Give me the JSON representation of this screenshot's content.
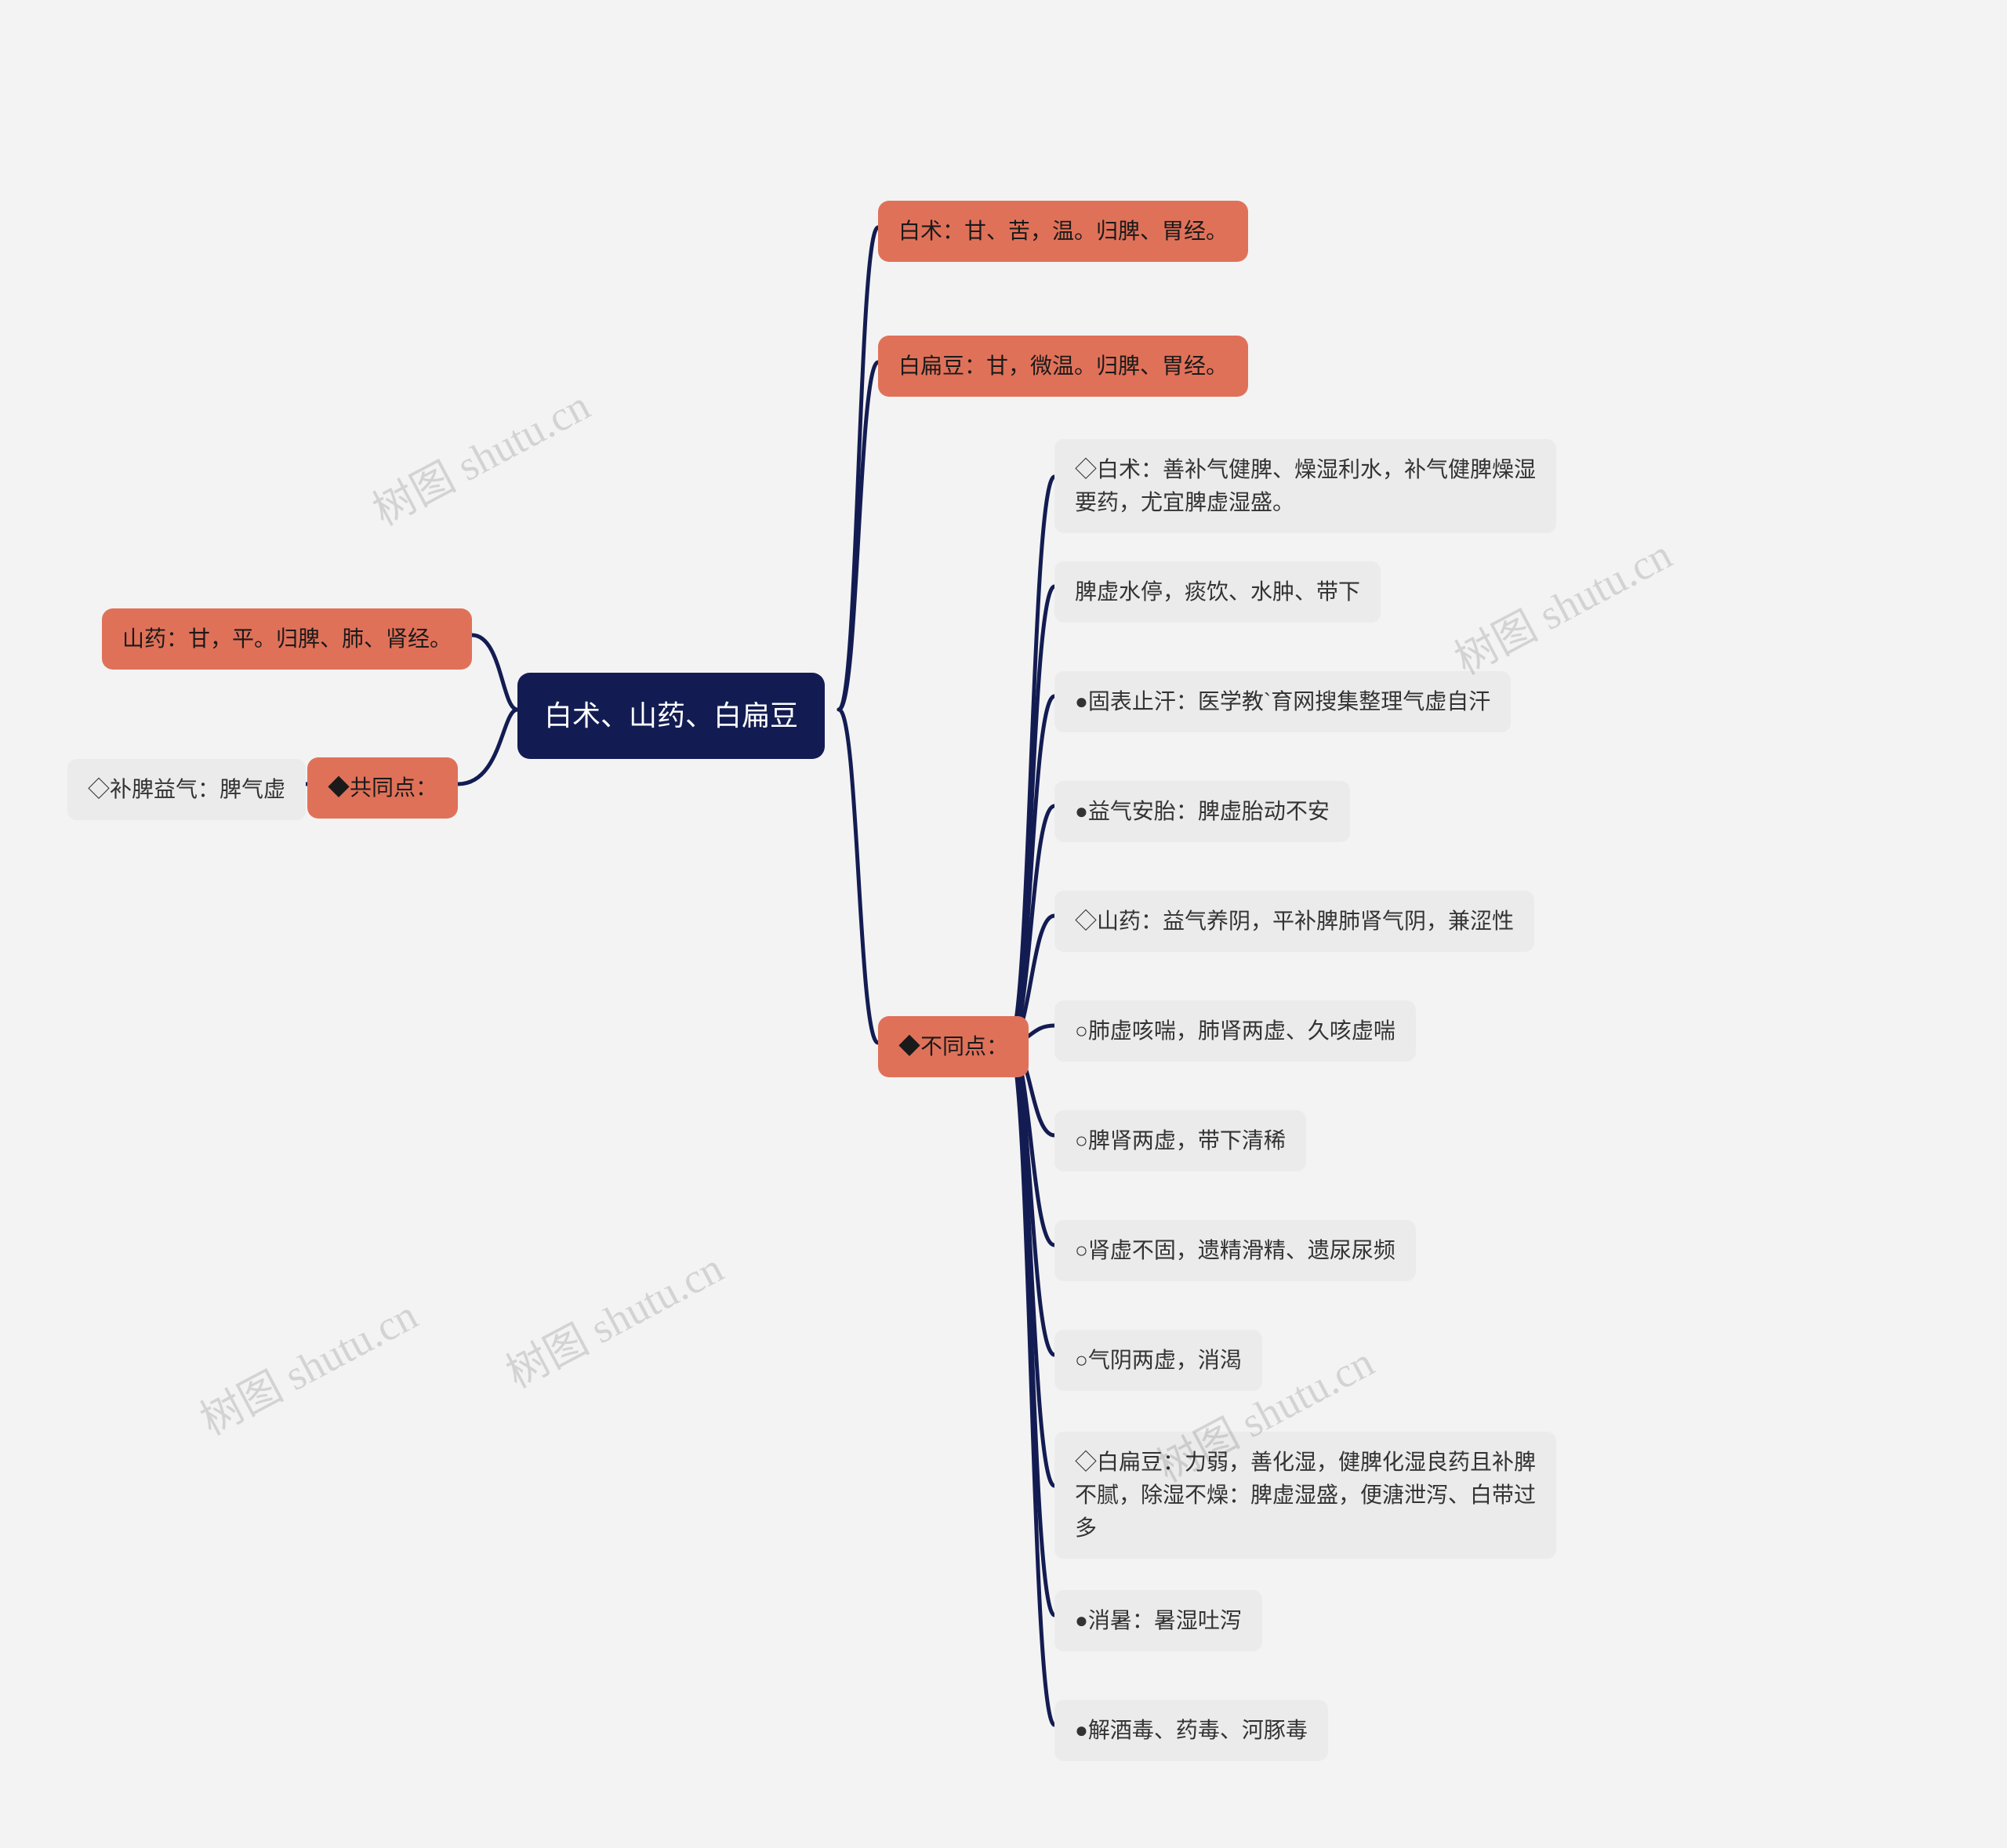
{
  "root": {
    "label": "白术、山药、白扁豆"
  },
  "left": {
    "shanyao": "山药：甘，平。归脾、肺、肾经。",
    "common_label": "◆共同点：",
    "common_detail": "◇补脾益气：脾气虚"
  },
  "right": {
    "baizhu": "白术：甘、苦，温。归脾、胃经。",
    "baibiandou": "白扁豆：甘，微温。归脾、胃经。",
    "diff_label": "◆不同点：",
    "diff_items": [
      "◇白术：善补气健脾、燥湿利水，补气健脾燥湿要药，尤宜脾虚湿盛。",
      "脾虚水停，痰饮、水肿、带下",
      "●固表止汗：医学教`育网搜集整理气虚自汗",
      "●益气安胎：脾虚胎动不安",
      "◇山药：益气养阴，平补脾肺肾气阴，兼涩性",
      "○肺虚咳喘，肺肾两虚、久咳虚喘",
      "○脾肾两虚，带下清稀",
      "○肾虚不固，遗精滑精、遗尿尿频",
      "○气阴两虚，消渴",
      "◇白扁豆：力弱，善化湿，健脾化湿良药且补脾不腻，除湿不燥：脾虚湿盛，便溏泄泻、白带过多",
      "●消暑：暑湿吐泻",
      "●解酒毒、药毒、河豚毒"
    ]
  },
  "watermark": "树图 shutu.cn"
}
